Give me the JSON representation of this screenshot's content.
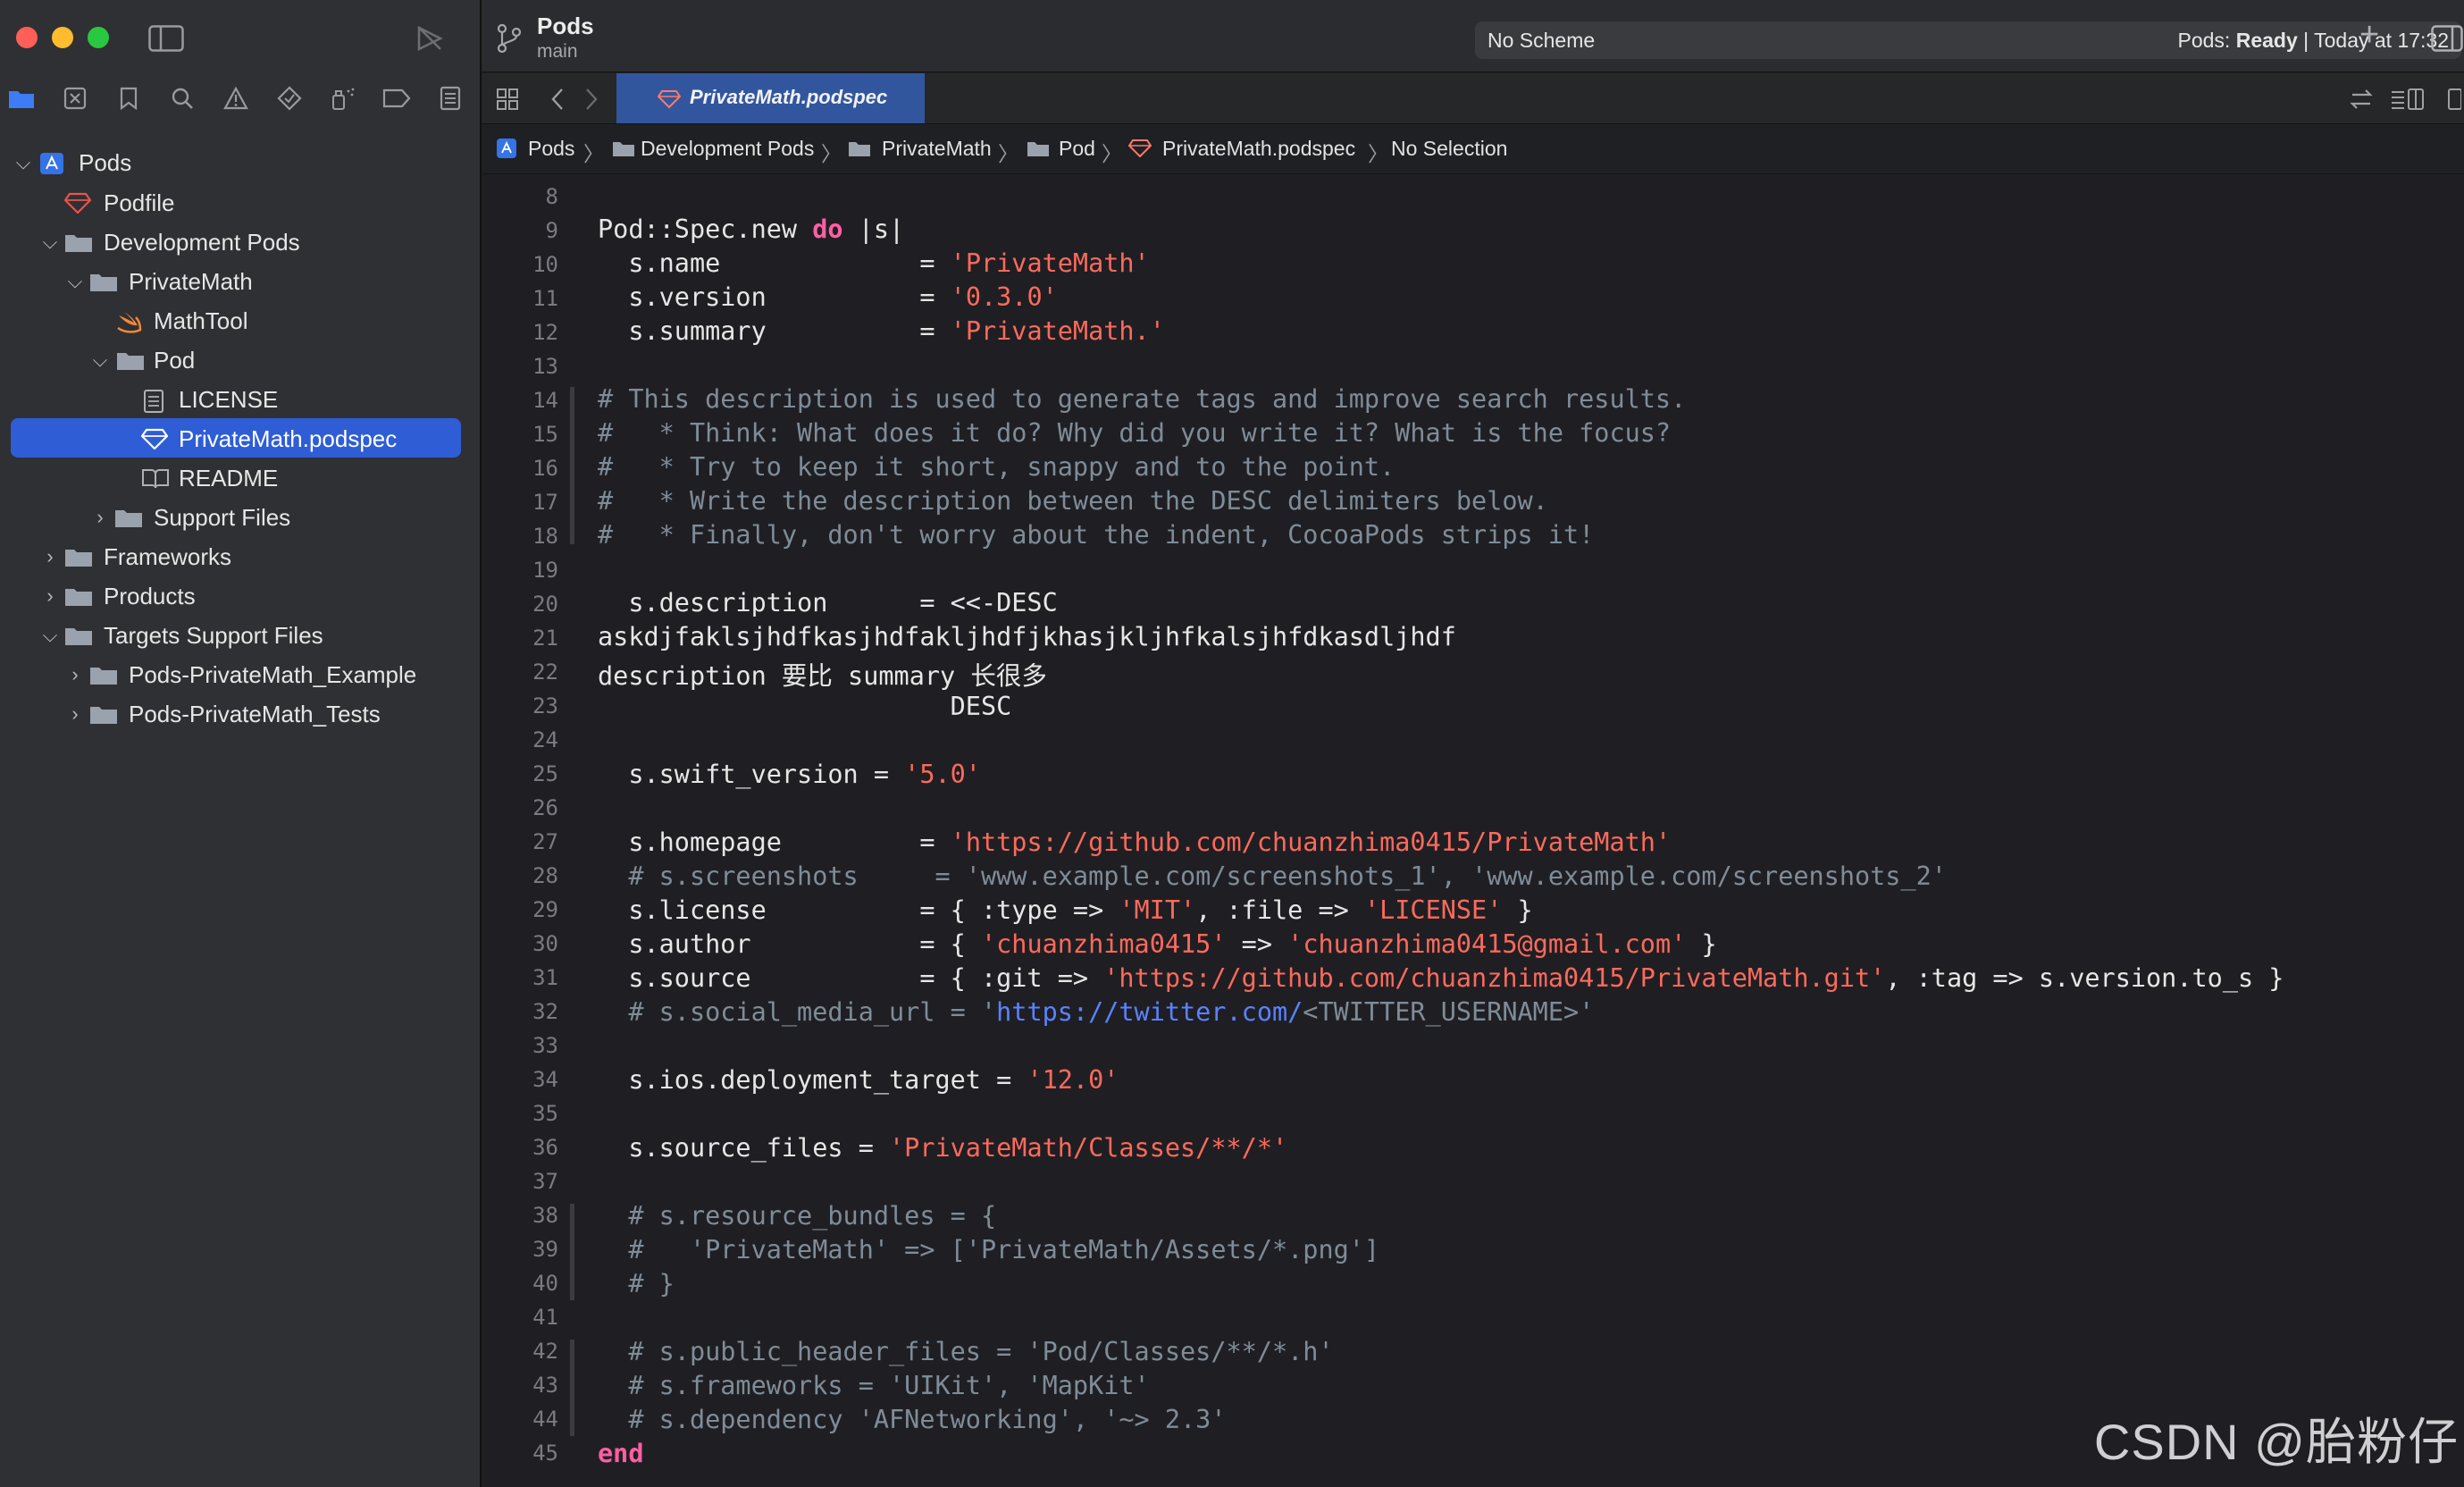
{
  "window": {
    "project": "Pods",
    "branch": "main"
  },
  "toolbar": {
    "scheme": "No Scheme",
    "status_prefix": "Pods: ",
    "status_state": "Ready",
    "status_suffix": " | Today at 17:32",
    "add_label": "+"
  },
  "tab": {
    "title": "PrivateMath.podspec"
  },
  "breadcrumb": [
    "Pods",
    "Development Pods",
    "PrivateMath",
    "Pod",
    "PrivateMath.podspec",
    "No Selection"
  ],
  "navigator": {
    "items": [
      {
        "label": "Pods",
        "icon": "project-icon"
      },
      {
        "label": "Podfile",
        "icon": "ruby-file-icon"
      },
      {
        "label": "Development Pods",
        "icon": "folder-icon"
      },
      {
        "label": "PrivateMath",
        "icon": "folder-icon"
      },
      {
        "label": "MathTool",
        "icon": "swift-file-icon"
      },
      {
        "label": "Pod",
        "icon": "folder-icon"
      },
      {
        "label": "LICENSE",
        "icon": "text-file-icon"
      },
      {
        "label": "PrivateMath.podspec",
        "icon": "ruby-file-icon"
      },
      {
        "label": "README",
        "icon": "book-icon"
      },
      {
        "label": "Support Files",
        "icon": "folder-icon"
      },
      {
        "label": "Frameworks",
        "icon": "folder-icon"
      },
      {
        "label": "Products",
        "icon": "folder-icon"
      },
      {
        "label": "Targets Support Files",
        "icon": "folder-icon"
      },
      {
        "label": "Pods-PrivateMath_Example",
        "icon": "folder-icon"
      },
      {
        "label": "Pods-PrivateMath_Tests",
        "icon": "folder-icon"
      }
    ],
    "selected": "PrivateMath.podspec"
  },
  "editor": {
    "line_numbers": [
      "8",
      "9",
      "10",
      "11",
      "12",
      "13",
      "14",
      "15",
      "16",
      "17",
      "18",
      "19",
      "20",
      "21",
      "22",
      "23",
      "24",
      "25",
      "26",
      "27",
      "28",
      "29",
      "30",
      "31",
      "32",
      "33",
      "34",
      "35",
      "36",
      "37",
      "38",
      "39",
      "40",
      "41",
      "42",
      "43",
      "44",
      "45"
    ],
    "code": {
      "l9a": "Pod::Spec.new ",
      "l9kw": "do",
      "l9b": " |s|",
      "l10a": "  s.name             = ",
      "l10s": "'PrivateMath'",
      "l11a": "  s.version          = ",
      "l11s": "'0.3.0'",
      "l12a": "  s.summary          = ",
      "l12s": "'PrivateMath.'",
      "l14": "# This description is used to generate tags and improve search results.",
      "l15": "#   * Think: What does it do? Why did you write it? What is the focus?",
      "l16": "#   * Try to keep it short, snappy and to the point.",
      "l17": "#   * Write the description between the DESC delimiters below.",
      "l18": "#   * Finally, don't worry about the indent, CocoaPods strips it!",
      "l20": "  s.description      = <<-DESC",
      "l21": "askdjfaklsjhdfkasjhdfakljhdfjkhasjkljhfkalsjhfdkasdljhdf",
      "l22": "description 要比 summary 长很多",
      "l23": "                       DESC",
      "l25a": "  s.swift_version = ",
      "l25s": "'5.0'",
      "l27a": "  s.homepage         = ",
      "l27s": "'https://github.com/chuanzhima0415/PrivateMath'",
      "l28": "  # s.screenshots     = 'www.example.com/screenshots_1', 'www.example.com/screenshots_2'",
      "l29a": "  s.license          = { :type => ",
      "l29s1": "'MIT'",
      "l29b": ", :file => ",
      "l29s2": "'LICENSE'",
      "l29c": " }",
      "l30a": "  s.author           = { ",
      "l30s1": "'chuanzhima0415'",
      "l30b": " => ",
      "l30s2": "'chuanzhima0415@gmail.com'",
      "l30c": " }",
      "l31a": "  s.source           = { :git => ",
      "l31s": "'https://github.com/chuanzhima0415/PrivateMath.git'",
      "l31b": ", :tag => s.version.to_s }",
      "l32a": "  # s.social_media_url = '",
      "l32u": "https://twitter.com/",
      "l32b": "<TWITTER_USERNAME>'",
      "l34a": "  s.ios.deployment_target = ",
      "l34s": "'12.0'",
      "l36a": "  s.source_files = ",
      "l36s": "'PrivateMath/Classes/**/*'",
      "l38": "  # s.resource_bundles = {",
      "l39": "  #   'PrivateMath' => ['PrivateMath/Assets/*.png']",
      "l40": "  # }",
      "l42": "  # s.public_header_files = 'Pod/Classes/**/*.h'",
      "l43": "  # s.frameworks = 'UIKit', 'MapKit'",
      "l44": "  # s.dependency 'AFNetworking', '~> 2.3'",
      "l45": "end"
    }
  },
  "watermark": "CSDN @胎粉仔",
  "colors": {
    "selection": "#2f5dd6",
    "keyword": "#fc5fa3",
    "string": "#fc6a5d",
    "comment": "#7f8c98",
    "url": "#5b82ff",
    "close": "#ff5f57",
    "minimize": "#febc2e",
    "zoom": "#28c840"
  }
}
